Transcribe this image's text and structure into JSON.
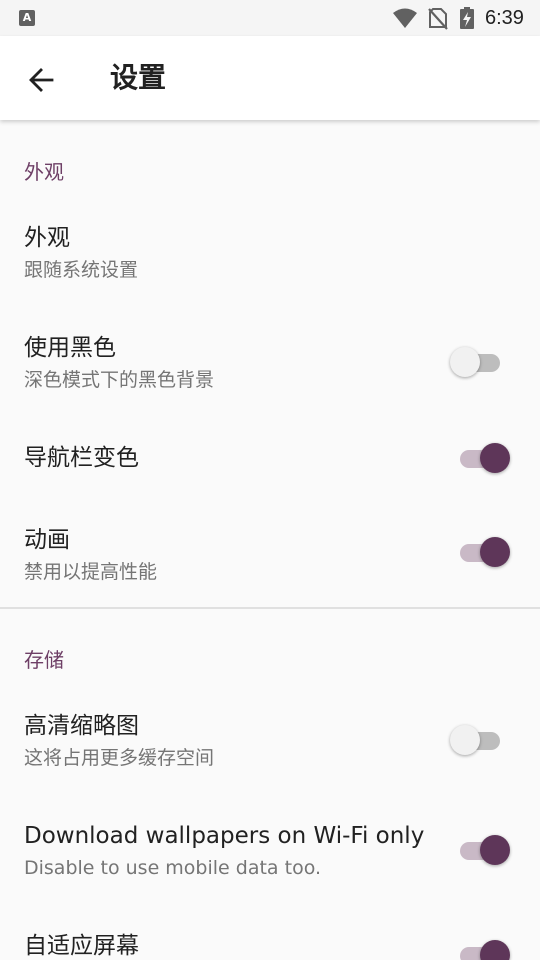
{
  "status_bar": {
    "notification_letter": "A",
    "time": "6:39",
    "icons": [
      "wifi-icon",
      "no-sim-icon",
      "battery-charging-icon"
    ]
  },
  "app_bar": {
    "back_icon": "arrow-left-icon",
    "title": "设置"
  },
  "sections": {
    "appearance": {
      "header": "外观",
      "items": [
        {
          "title": "外观",
          "subtitle": "跟随系统设置"
        },
        {
          "title": "使用黑色",
          "subtitle": "深色模式下的黑色背景",
          "toggle": false
        },
        {
          "title": "导航栏变色",
          "toggle": true
        },
        {
          "title": "动画",
          "subtitle": "禁用以提高性能",
          "toggle": true
        }
      ]
    },
    "storage": {
      "header": "存储",
      "items": [
        {
          "title": "高清缩略图",
          "subtitle": "这将占用更多缓存空间",
          "toggle": false
        },
        {
          "title": "Download wallpapers on Wi-Fi only",
          "subtitle": "Disable to use mobile data too.",
          "toggle": true
        },
        {
          "title": "自适应屏幕",
          "toggle": true
        }
      ]
    }
  },
  "colors": {
    "accent": "#5e3659",
    "accent_track": "#c9b9c6",
    "section_header": "#6e3f66",
    "background": "#fafafa"
  }
}
